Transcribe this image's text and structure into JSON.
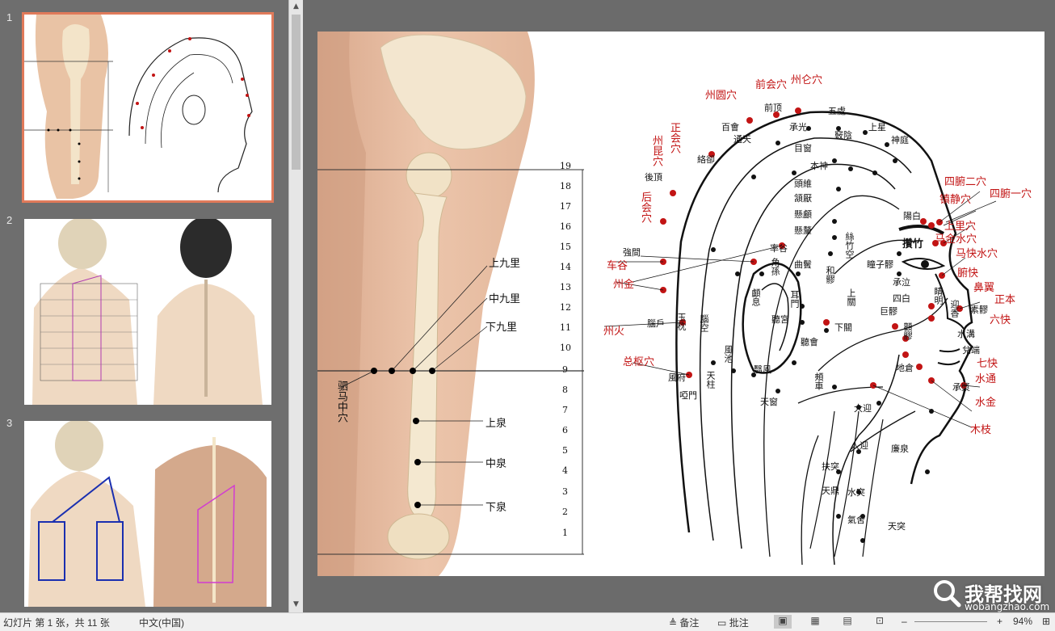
{
  "thumbnails": [
    {
      "number": "1",
      "selected": true
    },
    {
      "number": "2",
      "selected": false
    },
    {
      "number": "3",
      "selected": false
    }
  ],
  "slide": {
    "leg_labels": {
      "upper_nine": "上九里",
      "middle_nine": "中九里",
      "lower_nine": "下九里",
      "upper_spring": "上泉",
      "middle_spring": "中泉",
      "lower_spring": "下泉",
      "horse_point": "驷马中穴"
    },
    "scale_numbers": [
      "19",
      "18",
      "17",
      "16",
      "15",
      "14",
      "13",
      "12",
      "11",
      "10",
      "9",
      "8",
      "7",
      "6",
      "5",
      "4",
      "3",
      "2",
      "1"
    ],
    "head_red_labels": {
      "qianhui": "前会穴",
      "zhoulun": "州仑穴",
      "zhouyuan": "州圆穴",
      "zhenghui": "正会穴",
      "zhoukun": "州昆穴",
      "houhui": "后会穴",
      "chegu": "车谷",
      "zhoujin": "州金",
      "zhouhuo": "州火",
      "zongshu": "总枢穴",
      "siwan2": "四腑二穴",
      "zhenjing": "镇静穴",
      "siwan1": "四腑一穴",
      "shangli": "上里穴",
      "majinshui": "马金水穴",
      "makuaishui": "马快水穴",
      "fukuai": "腑快",
      "biyi": "鼻翼",
      "zhengben": "正本",
      "liukuai": "六快",
      "qikuai": "七快",
      "shuitong": "水通",
      "shuijin": "水金",
      "muzhi": "木枝"
    },
    "head_black_labels": {
      "qianding": "前顶",
      "baihui": "百會",
      "chengguang": "承光",
      "wuchu": "五處",
      "shangxing": "上星",
      "shenting": "神庭",
      "luoque": "絡卻",
      "tongtian": "通天",
      "muchuang": "目窗",
      "qiaoyin": "竅陰",
      "houding": "後頂",
      "qiangjian": "強間",
      "benshen": "本神",
      "xuanlu": "懸顱",
      "xuanli": "懸釐",
      "hanyan": "頷厭",
      "touwei": "頭維",
      "yangbai": "陽白",
      "cuanzhu": "攢竹",
      "sizhukong": "絲竹空",
      "tongziliao": "瞳子髎",
      "chengqi": "承泣",
      "sibai": "四白",
      "juliao": "巨髎",
      "quanliao": "顴髎",
      "dicang": "地倉",
      "yingxiang": "迎香",
      "suliao": "素髎",
      "shuigou": "水溝",
      "duiduan": "兌端",
      "chengjiang": "承漿",
      "xiaguan": "下關",
      "tinggong": "聽宮",
      "tinghui": "聽會",
      "jiache": "頰車",
      "daying": "大迎",
      "fengchi": "風池",
      "fengfu": "風府",
      "yamen": "啞門",
      "tianzhu": "天柱",
      "yifeng": "翳風",
      "tianchuang": "天窗",
      "renying": "人迎",
      "futu": "扶突",
      "shuitu": "水突",
      "tianding": "天鼎",
      "qishe": "氣舍",
      "tiantu": "天突",
      "lianquan": "廉泉",
      "luxi": "顱息",
      "jiaosun": "角孫",
      "shuaigu": "率谷",
      "naohu": "腦戶",
      "yuzhen": "玉枕",
      "naokong": "腦空",
      "qubin": "曲鬢",
      "heliao": "和髎",
      "ermen": "耳門",
      "shangguan": "上關",
      "jingming": "睛明"
    }
  },
  "statusbar": {
    "slide_info": "幻灯片 第 1 张，共 11 张",
    "language": "中文(中国)",
    "notes": "备注",
    "comments": "批注",
    "zoom": "94%"
  },
  "watermark": {
    "brand": "我帮找网",
    "url": "wobangzhao.com"
  }
}
